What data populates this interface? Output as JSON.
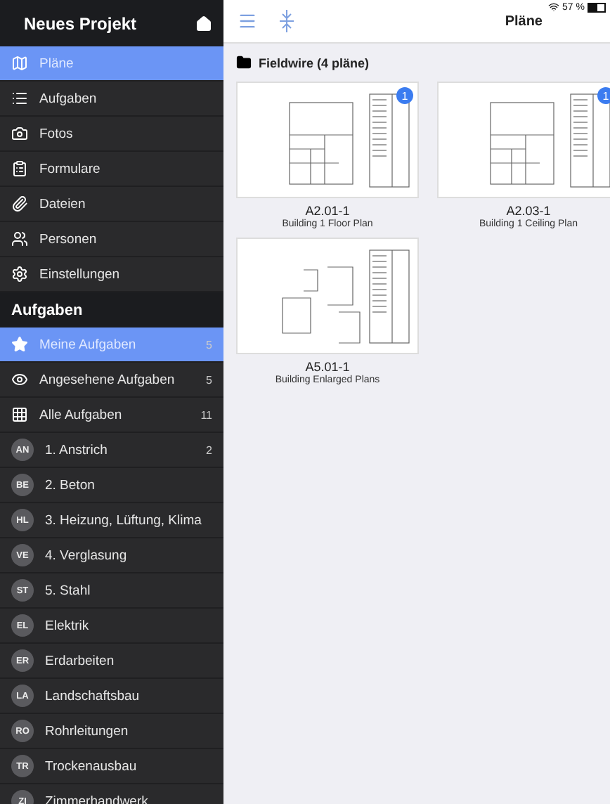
{
  "sidebar": {
    "title": "Neues Projekt",
    "nav": [
      {
        "label": "Pläne",
        "selected": true
      },
      {
        "label": "Aufgaben",
        "selected": false
      },
      {
        "label": "Fotos",
        "selected": false
      },
      {
        "label": "Formulare",
        "selected": false
      },
      {
        "label": "Dateien",
        "selected": false
      },
      {
        "label": "Personen",
        "selected": false
      },
      {
        "label": "Einstellungen",
        "selected": false
      }
    ],
    "section_title": "Aufgaben",
    "tasks": [
      {
        "kind": "filter",
        "label": "Meine Aufgaben",
        "count": "5",
        "selected": true
      },
      {
        "kind": "filter",
        "label": "Angesehene Aufgaben",
        "count": "5",
        "selected": false
      },
      {
        "kind": "filter",
        "label": "Alle Aufgaben",
        "count": "11",
        "selected": false
      },
      {
        "kind": "trade",
        "initials": "AN",
        "label": "1. Anstrich",
        "count": "2",
        "selected": false
      },
      {
        "kind": "trade",
        "initials": "BE",
        "label": "2. Beton",
        "selected": false
      },
      {
        "kind": "trade",
        "initials": "HL",
        "label": "3. Heizung, Lüftung, Klima",
        "selected": false
      },
      {
        "kind": "trade",
        "initials": "VE",
        "label": "4. Verglasung",
        "selected": false
      },
      {
        "kind": "trade",
        "initials": "ST",
        "label": "5. Stahl",
        "selected": false
      },
      {
        "kind": "trade",
        "initials": "EL",
        "label": "Elektrik",
        "selected": false
      },
      {
        "kind": "trade",
        "initials": "ER",
        "label": "Erdarbeiten",
        "selected": false
      },
      {
        "kind": "trade",
        "initials": "LA",
        "label": "Landschaftsbau",
        "selected": false
      },
      {
        "kind": "trade",
        "initials": "RO",
        "label": "Rohrleitungen",
        "selected": false
      },
      {
        "kind": "trade",
        "initials": "TR",
        "label": "Trockenausbau",
        "selected": false
      },
      {
        "kind": "trade",
        "initials": "ZI",
        "label": "Zimmerhandwerk",
        "selected": false
      }
    ]
  },
  "status_bar": {
    "battery": "57 %"
  },
  "main": {
    "title": "Pläne",
    "folder": "Fieldwire (4 pläne)",
    "plans": [
      {
        "title": "A2.01-1",
        "subtitle": "Building 1 Floor Plan",
        "badge": "1"
      },
      {
        "title": "A2.03-1",
        "subtitle": "Building 1 Ceiling Plan",
        "badge": "1"
      },
      {
        "title": "A5.01-1",
        "subtitle": "Building Enlarged Plans"
      }
    ]
  }
}
